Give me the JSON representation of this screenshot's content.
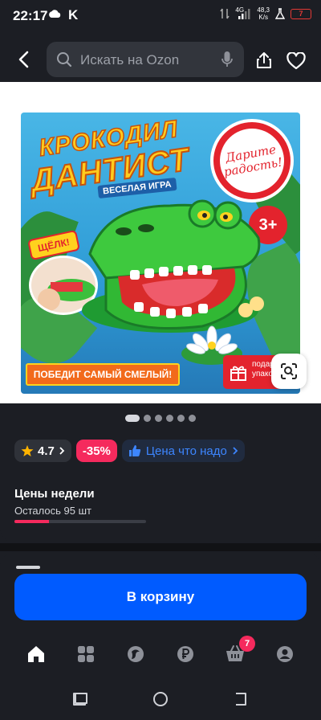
{
  "status_bar": {
    "time": "22:17",
    "k_app": "K",
    "network": "4G",
    "speed_value": "48,3",
    "speed_unit": "K/s",
    "battery": "7"
  },
  "header": {
    "search_placeholder": "Искать на Ozon"
  },
  "product_image": {
    "title_line1": "КРОКОДИЛ",
    "title_line2": "ДАНТИСТ",
    "subtitle": "ВЕСЕЛАЯ ИГРА",
    "gift_circle_line1": "Дарите",
    "gift_circle_line2": "радость!",
    "age": "3+",
    "sticker": "ЩЁЛК!",
    "slogan": "ПОБЕДИТ САМЫЙ СМЕЛЫЙ!",
    "gift_label": "подарочная упаковка",
    "gallery_total": 6,
    "gallery_active": 1
  },
  "chips": {
    "rating": "4.7",
    "discount": "-35%",
    "price_label": "Цена что надо"
  },
  "weekly": {
    "title": "Цены недели",
    "stock_text": "Осталось 95 шт",
    "stock_progress": 0.26
  },
  "actions": {
    "cart_button": "В корзину"
  },
  "bottom_nav": {
    "cart_badge": "7",
    "items": [
      "home-icon",
      "catalog-icon",
      "fresh-icon",
      "ruble-icon",
      "cart-icon",
      "profile-icon"
    ]
  },
  "colors": {
    "accent_blue": "#005bff",
    "accent_pink": "#f52a5d",
    "background": "#1c1e24"
  }
}
